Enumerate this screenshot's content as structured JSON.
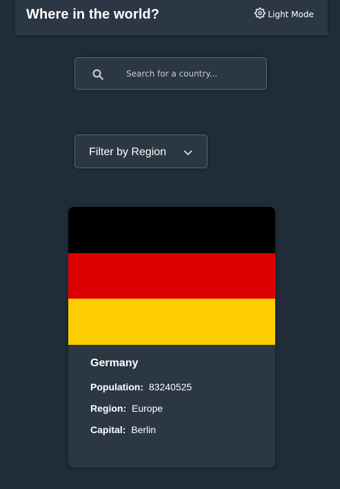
{
  "header": {
    "title": "Where in the world?",
    "mode_label": "Light Mode"
  },
  "search": {
    "placeholder": "Search for a country...",
    "value": ""
  },
  "filter": {
    "label": "Filter by Region"
  },
  "country": {
    "name": "Germany",
    "population_label": "Population:",
    "population": "83240525",
    "region_label": "Region:",
    "region": "Europe",
    "capital_label": "Capital:",
    "capital": "Berlin",
    "flag_colors": [
      "#000000",
      "#dd0000",
      "#ffce00"
    ]
  },
  "theme": {
    "background": "#202c37",
    "element": "#2b3743",
    "text": "#ffffff"
  }
}
